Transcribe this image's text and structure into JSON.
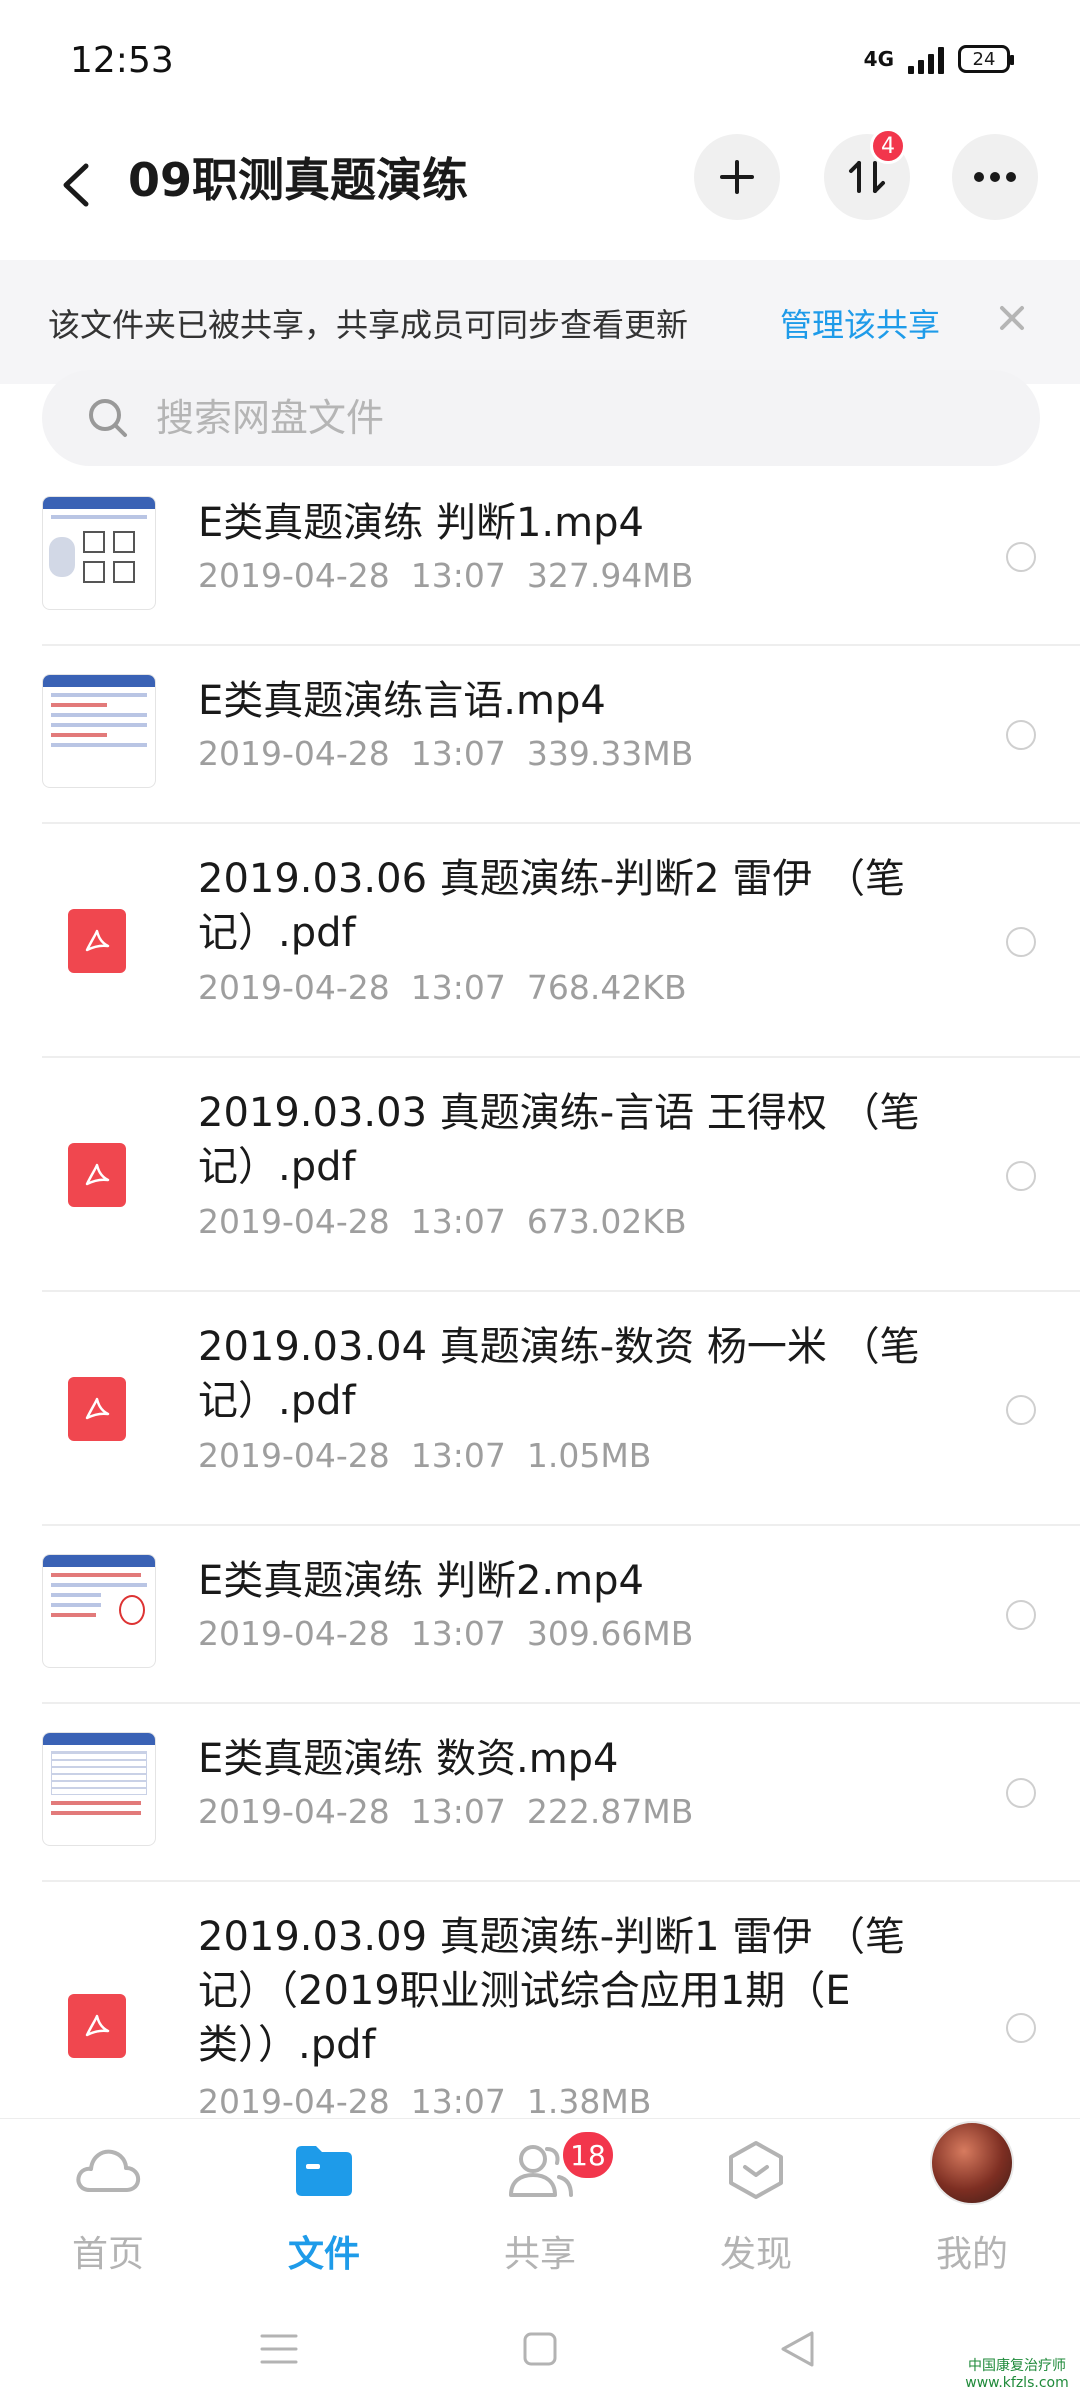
{
  "status_bar": {
    "time": "12:53",
    "network": "4G",
    "battery": "24"
  },
  "header": {
    "title": "09职测真题演练",
    "transfer_badge": "4"
  },
  "share_banner": {
    "text": "该文件夹已被共享，共享成员可同步查看更新",
    "manage_link": "管理该共享"
  },
  "search": {
    "placeholder": "搜索网盘文件"
  },
  "files": [
    {
      "type": "video",
      "name": "E类真题演练 判断1.mp4",
      "meta": "2019-04-28  13:07  327.94MB"
    },
    {
      "type": "video",
      "name": "E类真题演练言语.mp4",
      "meta": "2019-04-28  13:07  339.33MB"
    },
    {
      "type": "pdf",
      "name": "2019.03.06 真题演练-判断2 雷伊 （笔记）.pdf",
      "meta": "2019-04-28  13:07  768.42KB"
    },
    {
      "type": "pdf",
      "name": "2019.03.03 真题演练-言语 王得权 （笔记）.pdf",
      "meta": "2019-04-28  13:07  673.02KB"
    },
    {
      "type": "pdf",
      "name": "2019.03.04 真题演练-数资 杨一米 （笔记）.pdf",
      "meta": "2019-04-28  13:07  1.05MB"
    },
    {
      "type": "video",
      "name": "E类真题演练 判断2.mp4",
      "meta": "2019-04-28  13:07  309.66MB"
    },
    {
      "type": "video",
      "name": "E类真题演练 数资.mp4",
      "meta": "2019-04-28  13:07  222.87MB"
    },
    {
      "type": "pdf",
      "name": "2019.03.09 真题演练-判断1 雷伊 （笔记）（2019职业测试综合应用1期（E类））.pdf",
      "meta": "2019-04-28  13:07  1.38MB"
    }
  ],
  "bottom_nav": {
    "home": "首页",
    "files": "文件",
    "share": "共享",
    "share_badge": "18",
    "discover": "发现",
    "mine": "我的"
  },
  "watermark": {
    "line1": "中国康复治疗师",
    "line2": "www.kfzls.com"
  },
  "colors": {
    "accent": "#1e9be9",
    "badge": "#f2364c",
    "pdf": "#f0474f"
  }
}
